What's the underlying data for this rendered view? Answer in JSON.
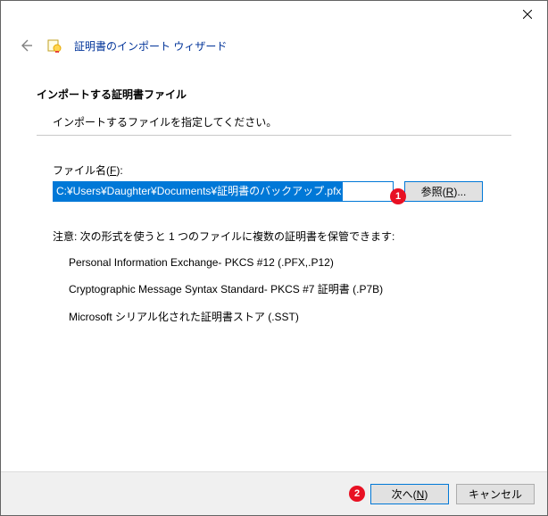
{
  "wizard": {
    "title": "証明書のインポート ウィザード",
    "section_heading": "インポートする証明書ファイル",
    "instruction": "インポートするファイルを指定してください。"
  },
  "file": {
    "label_prefix": "ファイル名(",
    "label_key": "F",
    "label_suffix": "):",
    "value": "C:¥Users¥Daughter¥Documents¥証明書のバックアップ.pfx",
    "browse_prefix": "参照(",
    "browse_key": "R",
    "browse_suffix": ")..."
  },
  "note": {
    "intro": "注意: 次の形式を使うと 1 つのファイルに複数の証明書を保管できます:",
    "items": [
      "Personal Information Exchange- PKCS #12 (.PFX,.P12)",
      "Cryptographic Message Syntax Standard- PKCS #7 証明書 (.P7B)",
      "Microsoft シリアル化された証明書ストア (.SST)"
    ]
  },
  "footer": {
    "next_prefix": "次へ(",
    "next_key": "N",
    "next_suffix": ")",
    "cancel": "キャンセル"
  },
  "callouts": {
    "one": "1",
    "two": "2"
  }
}
